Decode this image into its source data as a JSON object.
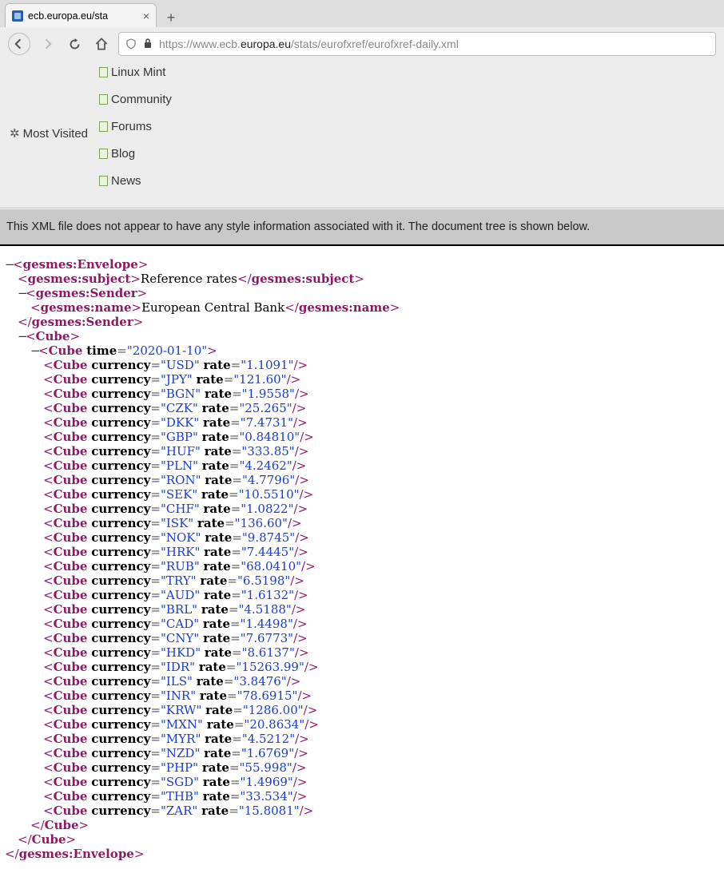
{
  "tab": {
    "title": "ecb.europa.eu/sta",
    "close": "×",
    "newtab": "+"
  },
  "nav": {
    "back": "←",
    "forward": "→",
    "reload": "⟳",
    "home": "⌂",
    "url_prefix": "https://www.ecb.",
    "url_domain": "europa.eu",
    "url_suffix": "/stats/eurofxref/eurofxref-daily.xml"
  },
  "bookmarks": {
    "most_visited": "Most Visited",
    "items": [
      "Linux Mint",
      "Community",
      "Forums",
      "Blog",
      "News"
    ]
  },
  "notice": "This XML file does not appear to have any style information associated with it. The document tree is shown below.",
  "xml": {
    "envelope_open": "gesmes:Envelope",
    "subject_tag": "gesmes:subject",
    "subject_text": "Reference rates",
    "sender_tag": "gesmes:Sender",
    "name_tag": "gesmes:name",
    "name_text": "European Central Bank",
    "cube": "Cube",
    "time_attr": "time",
    "time_val": "2020-01-10",
    "currency_attr": "currency",
    "rate_attr": "rate",
    "rates": [
      {
        "c": "USD",
        "r": "1.1091"
      },
      {
        "c": "JPY",
        "r": "121.60"
      },
      {
        "c": "BGN",
        "r": "1.9558"
      },
      {
        "c": "CZK",
        "r": "25.265"
      },
      {
        "c": "DKK",
        "r": "7.4731"
      },
      {
        "c": "GBP",
        "r": "0.84810"
      },
      {
        "c": "HUF",
        "r": "333.85"
      },
      {
        "c": "PLN",
        "r": "4.2462"
      },
      {
        "c": "RON",
        "r": "4.7796"
      },
      {
        "c": "SEK",
        "r": "10.5510"
      },
      {
        "c": "CHF",
        "r": "1.0822"
      },
      {
        "c": "ISK",
        "r": "136.60"
      },
      {
        "c": "NOK",
        "r": "9.8745"
      },
      {
        "c": "HRK",
        "r": "7.4445"
      },
      {
        "c": "RUB",
        "r": "68.0410"
      },
      {
        "c": "TRY",
        "r": "6.5198"
      },
      {
        "c": "AUD",
        "r": "1.6132"
      },
      {
        "c": "BRL",
        "r": "4.5188"
      },
      {
        "c": "CAD",
        "r": "1.4498"
      },
      {
        "c": "CNY",
        "r": "7.6773"
      },
      {
        "c": "HKD",
        "r": "8.6137"
      },
      {
        "c": "IDR",
        "r": "15263.99"
      },
      {
        "c": "ILS",
        "r": "3.8476"
      },
      {
        "c": "INR",
        "r": "78.6915"
      },
      {
        "c": "KRW",
        "r": "1286.00"
      },
      {
        "c": "MXN",
        "r": "20.8634"
      },
      {
        "c": "MYR",
        "r": "4.5212"
      },
      {
        "c": "NZD",
        "r": "1.6769"
      },
      {
        "c": "PHP",
        "r": "55.998"
      },
      {
        "c": "SGD",
        "r": "1.4969"
      },
      {
        "c": "THB",
        "r": "33.534"
      },
      {
        "c": "ZAR",
        "r": "15.8081"
      }
    ]
  }
}
